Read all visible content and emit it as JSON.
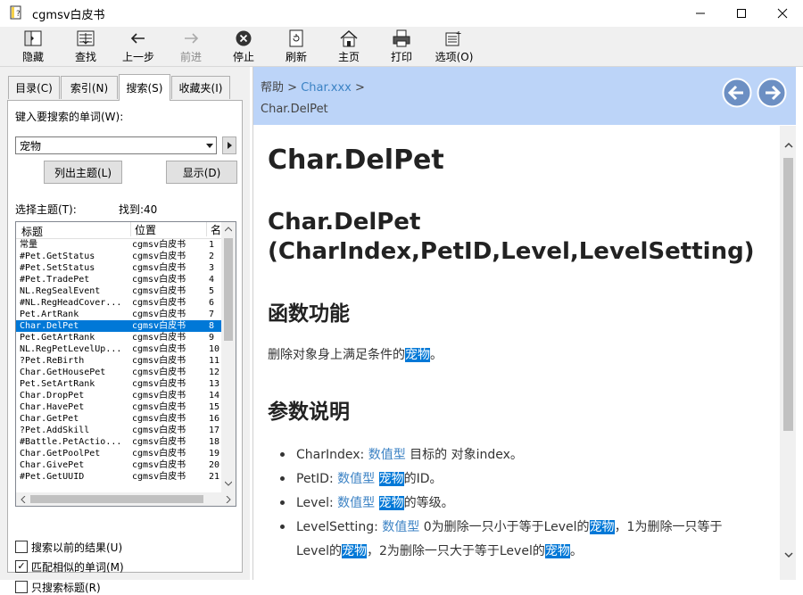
{
  "window": {
    "title": "cgmsv白皮书",
    "minimize": "—",
    "maximize": "☐",
    "close": "✕"
  },
  "toolbar": {
    "items": [
      {
        "label": "隐藏",
        "icon": "hide-icon"
      },
      {
        "label": "查找",
        "icon": "locate-icon"
      },
      {
        "label": "上一步",
        "icon": "back-arrow-icon"
      },
      {
        "label": "前进",
        "icon": "forward-arrow-icon",
        "disabled": true
      },
      {
        "label": "停止",
        "icon": "stop-icon"
      },
      {
        "label": "刷新",
        "icon": "refresh-icon"
      },
      {
        "label": "主页",
        "icon": "home-icon"
      },
      {
        "label": "打印",
        "icon": "print-icon"
      },
      {
        "label": "选项(O)",
        "icon": "options-icon"
      }
    ]
  },
  "tabs": [
    {
      "label": "目录(C)"
    },
    {
      "label": "索引(N)"
    },
    {
      "label": "搜索(S)",
      "active": true
    },
    {
      "label": "收藏夹(I)"
    }
  ],
  "search": {
    "prompt": "键入要搜索的单词(W):",
    "value": "宠物",
    "list_topics_button": "列出主题(L)",
    "display_button": "显示(D)",
    "select_topic_label": "选择主题(T):",
    "found": "找到:40"
  },
  "results": {
    "columns": [
      "标题",
      "位置",
      "名"
    ],
    "rows": [
      {
        "title": "常量",
        "location": "cgmsv白皮书",
        "rank": "1"
      },
      {
        "title": "#Pet.GetStatus",
        "location": "cgmsv白皮书",
        "rank": "2"
      },
      {
        "title": "#Pet.SetStatus",
        "location": "cgmsv白皮书",
        "rank": "3"
      },
      {
        "title": "#Pet.TradePet",
        "location": "cgmsv白皮书",
        "rank": "4"
      },
      {
        "title": "NL.RegSealEvent",
        "location": "cgmsv白皮书",
        "rank": "5"
      },
      {
        "title": "#NL.RegHeadCover...",
        "location": "cgmsv白皮书",
        "rank": "6"
      },
      {
        "title": "Pet.ArtRank",
        "location": "cgmsv白皮书",
        "rank": "7"
      },
      {
        "title": "Char.DelPet",
        "location": "cgmsv白皮书",
        "rank": "8",
        "selected": true
      },
      {
        "title": "Pet.GetArtRank",
        "location": "cgmsv白皮书",
        "rank": "9"
      },
      {
        "title": "NL.RegPetLevelUp...",
        "location": "cgmsv白皮书",
        "rank": "10"
      },
      {
        "title": "?Pet.ReBirth",
        "location": "cgmsv白皮书",
        "rank": "11"
      },
      {
        "title": "Char.GetHousePet",
        "location": "cgmsv白皮书",
        "rank": "12"
      },
      {
        "title": "Pet.SetArtRank",
        "location": "cgmsv白皮书",
        "rank": "13"
      },
      {
        "title": "Char.DropPet",
        "location": "cgmsv白皮书",
        "rank": "14"
      },
      {
        "title": "Char.HavePet",
        "location": "cgmsv白皮书",
        "rank": "15"
      },
      {
        "title": "Char.GetPet",
        "location": "cgmsv白皮书",
        "rank": "16"
      },
      {
        "title": "?Pet.AddSkill",
        "location": "cgmsv白皮书",
        "rank": "17"
      },
      {
        "title": "#Battle.PetActio...",
        "location": "cgmsv白皮书",
        "rank": "18"
      },
      {
        "title": "Char.GetPoolPet",
        "location": "cgmsv白皮书",
        "rank": "19"
      },
      {
        "title": "Char.GivePet",
        "location": "cgmsv白皮书",
        "rank": "20"
      },
      {
        "title": "#Pet.GetUUID",
        "location": "cgmsv白皮书",
        "rank": "21"
      }
    ]
  },
  "options": [
    {
      "label": "搜索以前的结果(U)",
      "checked": false
    },
    {
      "label": "匹配相似的单词(M)",
      "checked": true
    },
    {
      "label": "只搜索标题(R)",
      "checked": false
    }
  ],
  "breadcrumb": {
    "root": "帮助",
    "sep1": ">",
    "parent": "Char.xxx",
    "sep2": ">",
    "current": "Char.DelPet"
  },
  "content": {
    "h1": "Char.DelPet",
    "h2_line1": "Char.DelPet",
    "h2_line2": "(CharIndex,PetID,Level,LevelSetting)",
    "section1_title": "函数功能",
    "desc_pre": "删除对象身上满足条件的",
    "desc_hl": "宠物",
    "desc_post": "。",
    "section2_title": "参数说明",
    "params": {
      "p1_name": "CharIndex: ",
      "p1_type": "数值型",
      "p1_text": " 目标的 对象index。",
      "p2_name": "PetID: ",
      "p2_type": "数值型",
      "p2_hl": "宠物",
      "p2_text": "的ID。",
      "p3_name": "Level: ",
      "p3_type": "数值型",
      "p3_hl": "宠物",
      "p3_text": "的等级。",
      "p4_name": "LevelSetting: ",
      "p4_type": "数值型",
      "p4_text1": " 0为删除一只小于等于Level的",
      "p4_hl1": "宠物",
      "p4_text2": "，1为删除一只等于",
      "p4_line2_pre": "Level的",
      "p4_hl2": "宠物",
      "p4_text3": "，2为删除一只大于等于Level的",
      "p4_hl3": "宠物",
      "p4_text4": "。"
    }
  },
  "colors": {
    "navbar": "#bcd4f8",
    "selection": "#0078d7",
    "link": "#3b82c4"
  }
}
